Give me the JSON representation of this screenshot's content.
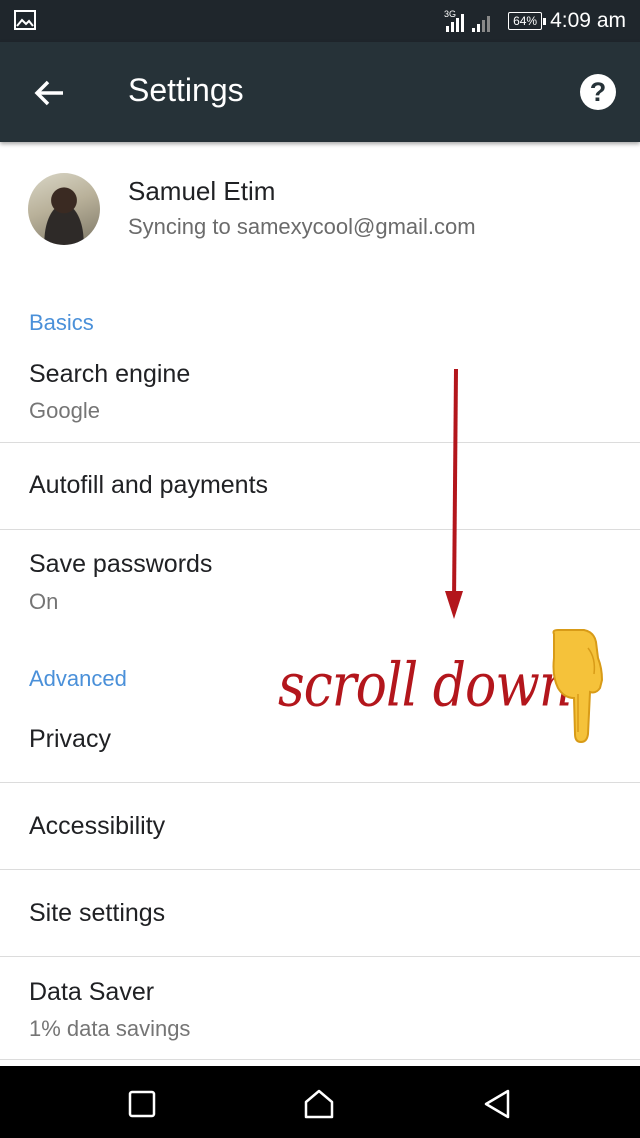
{
  "status_bar": {
    "network": "3G",
    "battery": "64%",
    "time": "4:09 am"
  },
  "toolbar": {
    "title": "Settings",
    "back_icon": "arrow-back-icon",
    "help_icon": "help-icon"
  },
  "account": {
    "name": "Samuel Etim",
    "sync": "Syncing to samexycool@gmail.com"
  },
  "sections": {
    "basics": "Basics",
    "advanced": "Advanced"
  },
  "items": {
    "search_engine": {
      "label": "Search engine",
      "value": "Google"
    },
    "autofill": {
      "label": "Autofill and payments"
    },
    "save_passwords": {
      "label": "Save passwords",
      "value": "On"
    },
    "privacy": {
      "label": "Privacy"
    },
    "accessibility": {
      "label": "Accessibility"
    },
    "site_settings": {
      "label": "Site settings"
    },
    "data_saver": {
      "label": "Data Saver",
      "value": "1% data savings"
    }
  },
  "overlay": {
    "text": "scroll down",
    "accent": "#b3161c"
  },
  "colors": {
    "toolbar": "#263238",
    "status_bar": "#1f262c",
    "section_header": "#4a90d9"
  }
}
